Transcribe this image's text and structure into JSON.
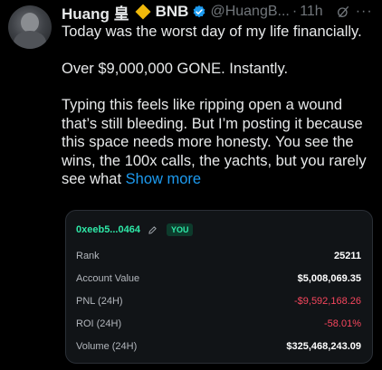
{
  "author": {
    "name": "Huang 皇",
    "badge_text": "BNB",
    "handle": "@HuangB...",
    "separator": "·",
    "time": "11h",
    "more": "···"
  },
  "tweet": {
    "line1": "Today was the worst day of my life financially.",
    "line2": "Over $9,000,000 GONE. Instantly.",
    "line3": "Typing this feels like ripping open a wound that’s still bleeding. But I’m posting it because this space needs more honesty. You see the wins, the 100x calls, the yachts, but you rarely see what",
    "show_more": "Show more"
  },
  "card": {
    "address": "0xeeb5...0464",
    "you_badge": "YOU",
    "rows": [
      {
        "label": "Rank",
        "value": "25211"
      },
      {
        "label": "Account Value",
        "value": "$5,008,069.35"
      },
      {
        "label": "PNL (24H)",
        "value": "-$9,592,168.26"
      },
      {
        "label": "ROI (24H)",
        "value": "-58.01%"
      },
      {
        "label": "Volume (24H)",
        "value": "$325,468,243.09"
      }
    ]
  },
  "colors": {
    "accent_link": "#1d9bf0",
    "positive_green": "#2ee8a7",
    "negative_red": "#f6465d",
    "binance_gold": "#f0b90b"
  },
  "icons": [
    "avatar",
    "binance-diamond-icon",
    "verified-icon",
    "grok-icon",
    "more-icon",
    "edit-pencil-icon"
  ]
}
